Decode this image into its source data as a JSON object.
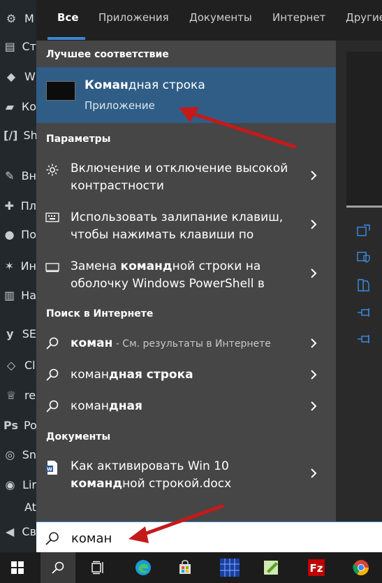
{
  "wp_sidebar": [
    {
      "label": "M",
      "icon": "media-icon"
    },
    {
      "label": "Ст",
      "icon": "pages-icon"
    },
    {
      "label": "W",
      "icon": "code-icon"
    },
    {
      "label": "Ко",
      "icon": "comments-icon"
    },
    {
      "label": "Sh",
      "icon": "shortcode-icon"
    },
    {
      "label": "Вн",
      "icon": "appearance-icon"
    },
    {
      "label": "Пл",
      "icon": "plugins-icon"
    },
    {
      "label": "По",
      "icon": "users-icon"
    },
    {
      "label": "Ин",
      "icon": "tools-icon"
    },
    {
      "label": "На",
      "icon": "settings-icon"
    },
    {
      "label": "SE",
      "icon": "yoast-icon"
    },
    {
      "label": "Cl",
      "icon": "diamond-icon"
    },
    {
      "label": "re",
      "icon": "crown-icon"
    },
    {
      "label": "Po",
      "icon": "ps-icon"
    },
    {
      "label": "Sn",
      "icon": "snip-icon"
    },
    {
      "label": "Lir",
      "icon": "fingerprint-icon"
    },
    {
      "label": "At",
      "icon": ""
    },
    {
      "label": "Св",
      "icon": "collapse-icon"
    }
  ],
  "tabs": [
    "Все",
    "Приложения",
    "Документы",
    "Интернет",
    "Другие"
  ],
  "sections": {
    "best": "Лучшее соответствие",
    "settings": "Параметры",
    "web": "Поиск в Интернете",
    "docs": "Документы"
  },
  "best_match": {
    "title_bold": "Коман",
    "title_rest": "дная строка",
    "category": "Приложение"
  },
  "settings_items": [
    {
      "icon": "brightness-icon",
      "line1": "Включение и отключение высокой",
      "line2": "контрастности"
    },
    {
      "icon": "keyboard-icon",
      "line1": "Использовать залипание клавиш,",
      "line2": "чтобы нажимать клавиши по"
    },
    {
      "icon": "monitor-icon",
      "line1_pre": "Замена ",
      "line1_bold": "команд",
      "line1_post": "ной строки на",
      "line2": "оболочку Windows PowerShell в"
    }
  ],
  "web_items": [
    {
      "bold": "коман",
      "rest": "",
      "suffix": " - См. результаты в Интернете"
    },
    {
      "bold": "коман",
      "rest": "дная строка",
      "suffix": ""
    },
    {
      "bold": "коман",
      "rest": "дная",
      "suffix": ""
    }
  ],
  "doc_item": {
    "line1": "Как активировать Win 10",
    "line2_bold": "команд",
    "line2_rest": "ной строкой.docx"
  },
  "search": {
    "value": "коман"
  },
  "colors": {
    "accent": "#3c86d6",
    "highlight": "#2f5d86",
    "arrow": "#c41a1a"
  }
}
